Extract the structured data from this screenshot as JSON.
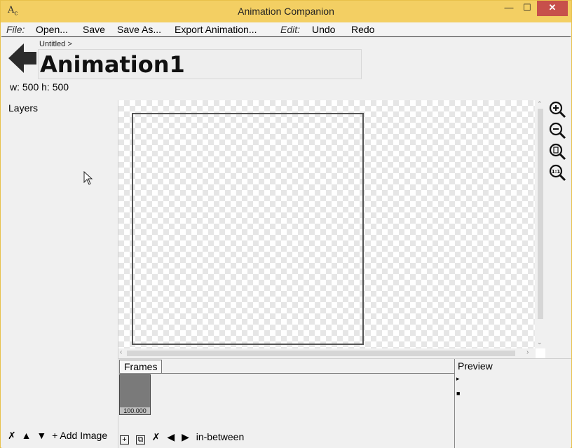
{
  "window": {
    "title": "Animation Companion",
    "app_icon_text": "AC",
    "minimize": "—",
    "maximize": "☐",
    "close": "✕"
  },
  "menu": {
    "file_section": "File:",
    "open": "Open...",
    "save": "Save",
    "save_as": "Save As...",
    "export": "Export Animation...",
    "edit_section": "Edit:",
    "undo": "Undo",
    "redo": "Redo"
  },
  "header": {
    "breadcrumb": "Untitled >",
    "animation_name": "Animation1",
    "dimensions": "w: 500 h: 500",
    "back_icon": "back-arrow-icon"
  },
  "layers": {
    "title": "Layers",
    "delete": "✗",
    "move_up": "▲",
    "move_down": "▼",
    "add_image": "+ Add Image"
  },
  "zoom_tools": [
    "zoom-in-icon",
    "zoom-out-icon",
    "zoom-fit-icon",
    "zoom-actual-size-icon"
  ],
  "frames": {
    "tab_label": "Frames",
    "items": [
      {
        "duration": "100.000"
      }
    ],
    "toolbar": {
      "add": "+",
      "duplicate": "⧉",
      "delete": "✗",
      "prev": "◀",
      "next": "▶",
      "in_between": "in-between"
    }
  },
  "preview": {
    "title": "Preview",
    "play": "▸",
    "stop": "■"
  },
  "colors": {
    "titlebar": "#f3cf63",
    "close_button": "#c7504b",
    "frame_thumb": "#7a7a7a"
  }
}
